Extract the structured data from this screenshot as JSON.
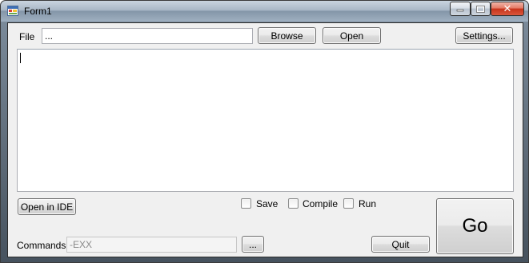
{
  "window": {
    "title": "Form1"
  },
  "file_row": {
    "label": "File",
    "path_value": "...",
    "browse_label": "Browse",
    "open_label": "Open",
    "settings_label": "Settings..."
  },
  "editor": {
    "content": ""
  },
  "options": {
    "open_ide_label": "Open in IDE",
    "save_label": "Save",
    "compile_label": "Compile",
    "run_label": "Run",
    "save_checked": false,
    "compile_checked": false,
    "run_checked": false
  },
  "commands_row": {
    "label": "Commands",
    "value": "-EXX",
    "ellipsis_label": "...",
    "quit_label": "Quit",
    "go_label": "Go"
  },
  "icons": {
    "app": "form-app-icon",
    "minimize": "minimize-icon",
    "maximize": "maximize-icon",
    "close": "close-icon"
  }
}
